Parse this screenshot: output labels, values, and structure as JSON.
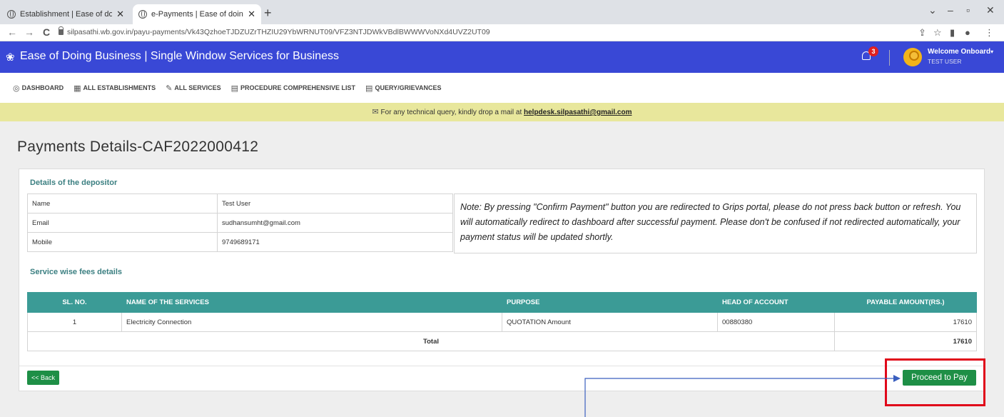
{
  "browser": {
    "tabs": [
      {
        "title": "Establishment | Ease of doing bu",
        "active": false
      },
      {
        "title": "e-Payments | Ease of doing busi",
        "active": true
      }
    ],
    "new_tab": "+",
    "url": "silpasathi.wb.gov.in/payu-payments/Vk43QzhoeTJDZUZrTHZIU29YbWRNUT09/VFZ3NTJDWkVBdlBWWWVoNXd4UVZ2UT09",
    "controls": {
      "chevron": "⌄",
      "minimize": "–",
      "maximize": "▫",
      "close": "✕"
    },
    "icons": {
      "back": "←",
      "forward": "→",
      "reload": "C",
      "share": "⇪",
      "star": "☆",
      "panel": "▮",
      "profile": "●",
      "menu": "⋮"
    }
  },
  "header": {
    "logo_icon": "❀",
    "title": "Ease of Doing Business | Single Window Services for Business",
    "notification_count": "3",
    "welcome": "Welcome Onboard",
    "caret": "▾",
    "user": "TEST USER"
  },
  "menu": [
    {
      "icon": "◎",
      "label": "DASHBOARD"
    },
    {
      "icon": "▦",
      "label": "ALL ESTABLISHMENTS"
    },
    {
      "icon": "✎",
      "label": "ALL SERVICES"
    },
    {
      "icon": "▤",
      "label": "PROCEDURE COMPREHENSIVE LIST"
    },
    {
      "icon": "▤",
      "label": "QUERY/GRIEVANCES"
    }
  ],
  "notice": {
    "icon": "✉",
    "text": "For any technical query, kindly drop a mail at",
    "email": "helpdesk.silpasathi@gmail.com"
  },
  "page_title": "Payments Details-CAF2022000412",
  "depositor": {
    "heading": "Details of the depositor",
    "rows": [
      {
        "label": "Name",
        "value": "Test User"
      },
      {
        "label": "Email",
        "value": "sudhansumht@gmail.com"
      },
      {
        "label": "Mobile",
        "value": "9749689171"
      }
    ],
    "note": "Note: By pressing \"Confirm Payment\" button you are redirected to Grips portal, please do not press back button or refresh. You will automatically redirect to dashboard after successful payment. Please don't be confused if not redirected automatically, your payment status will be updated shortly."
  },
  "fees": {
    "heading": "Service wise fees details",
    "columns": [
      "SL. NO.",
      "NAME OF THE SERVICES",
      "PURPOSE",
      "HEAD OF ACCOUNT",
      "PAYABLE AMOUNT(RS.)"
    ],
    "rows": [
      {
        "sl": "1",
        "service": "Electricity Connection",
        "purpose": "QUOTATION Amount",
        "head": "00880380",
        "amount": "17610"
      }
    ],
    "total_label": "Total",
    "total_amount": "17610"
  },
  "buttons": {
    "back": "<< Back",
    "proceed": "Proceed to Pay"
  },
  "annotation": {
    "highlight_color": "#e0081a",
    "arrow_color": "#3a5fbf"
  }
}
